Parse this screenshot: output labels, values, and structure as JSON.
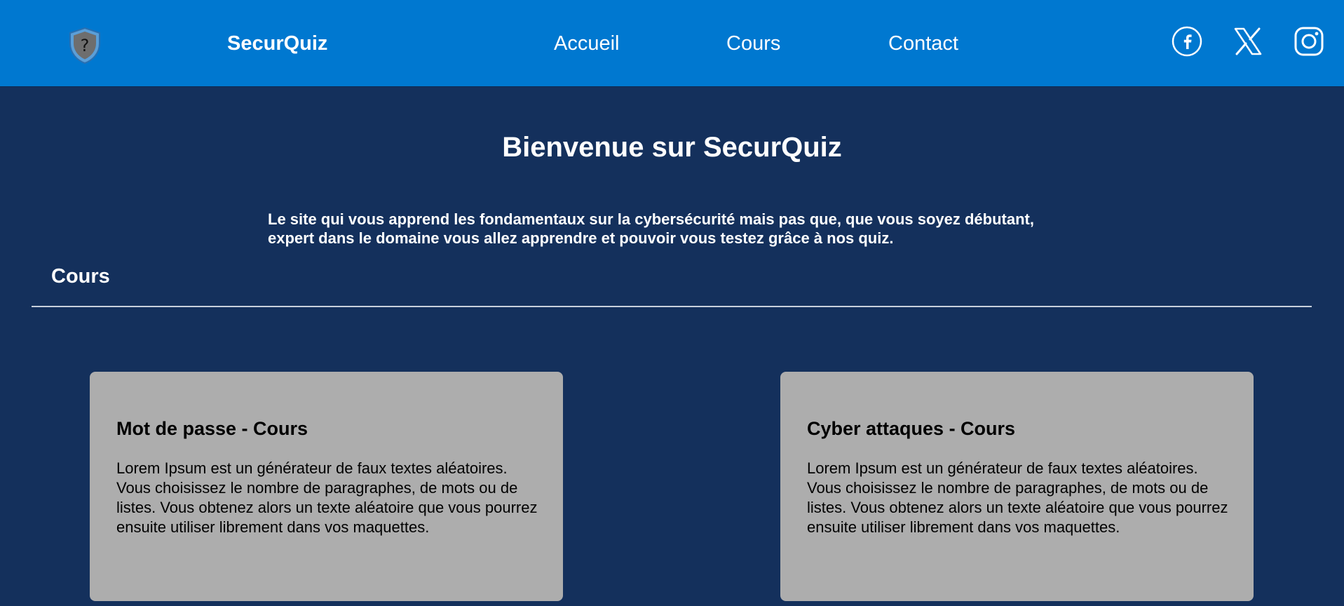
{
  "header": {
    "brand": "SecurQuiz",
    "logo_icon": "shield-question-icon",
    "nav": [
      {
        "label": "Accueil"
      },
      {
        "label": "Cours"
      },
      {
        "label": "Contact"
      }
    ],
    "social": [
      {
        "name": "facebook-icon"
      },
      {
        "name": "x-icon"
      },
      {
        "name": "instagram-icon"
      }
    ]
  },
  "hero": {
    "title": "Bienvenue sur SecurQuiz",
    "text": "Le site qui vous apprend les fondamentaux sur la cybersécurité mais pas que, que vous soyez débutant, expert dans le domaine vous allez apprendre et pouvoir vous testez grâce à nos quiz."
  },
  "section": {
    "title": "Cours"
  },
  "cards": [
    {
      "title": "Mot de passe - Cours",
      "text": "Lorem Ipsum est un générateur de faux textes aléatoires. Vous choisissez le nombre de paragraphes, de mots ou de listes. Vous obtenez alors un texte aléatoire que vous pourrez ensuite utiliser librement dans vos maquettes."
    },
    {
      "title": "Cyber attaques - Cours",
      "text": "Lorem Ipsum est un générateur de faux textes aléatoires. Vous choisissez le nombre de paragraphes, de mots ou de  listes. Vous obtenez alors un texte aléatoire que vous pourrez ensuite utiliser librement dans vos maquettes."
    }
  ],
  "colors": {
    "header": "#0078d0",
    "background": "#14305c",
    "card": "#adadad"
  }
}
